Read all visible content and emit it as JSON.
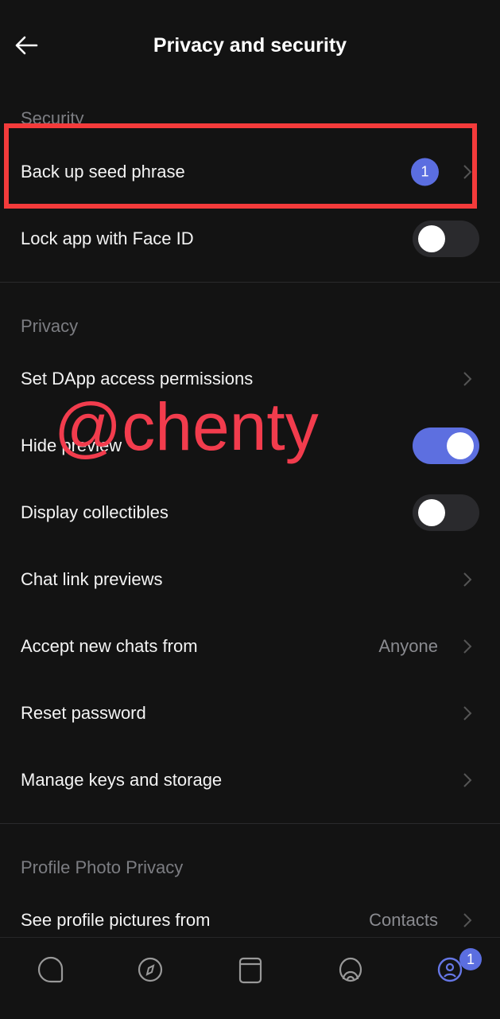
{
  "header": {
    "title": "Privacy and security",
    "back_icon": "arrow-left-icon"
  },
  "security": {
    "title": "Security",
    "items": [
      {
        "label": "Back up seed phrase",
        "badge": "1"
      },
      {
        "label": "Lock app with Face ID",
        "toggle": false
      }
    ]
  },
  "privacy": {
    "title": "Privacy",
    "items": [
      {
        "label": "Set DApp access permissions"
      },
      {
        "label": "Hide preview",
        "toggle": true
      },
      {
        "label": "Display collectibles",
        "toggle": false
      },
      {
        "label": "Chat link previews"
      },
      {
        "label": "Accept new chats from",
        "value": "Anyone"
      },
      {
        "label": "Reset password"
      },
      {
        "label": "Manage keys and storage"
      }
    ]
  },
  "profile_photo": {
    "title": "Profile Photo Privacy",
    "items": [
      {
        "label": "See profile pictures from",
        "value": "Contacts"
      }
    ]
  },
  "watermark": "@chenty",
  "tabbar": {
    "tabs": [
      "chat-icon",
      "compass-icon",
      "wallet-icon",
      "activity-icon",
      "profile-icon"
    ],
    "active": "profile-icon",
    "profile_badge": "1"
  },
  "colors": {
    "accent": "#5b6ee0",
    "highlight": "#f43b3b",
    "background": "#131313"
  }
}
